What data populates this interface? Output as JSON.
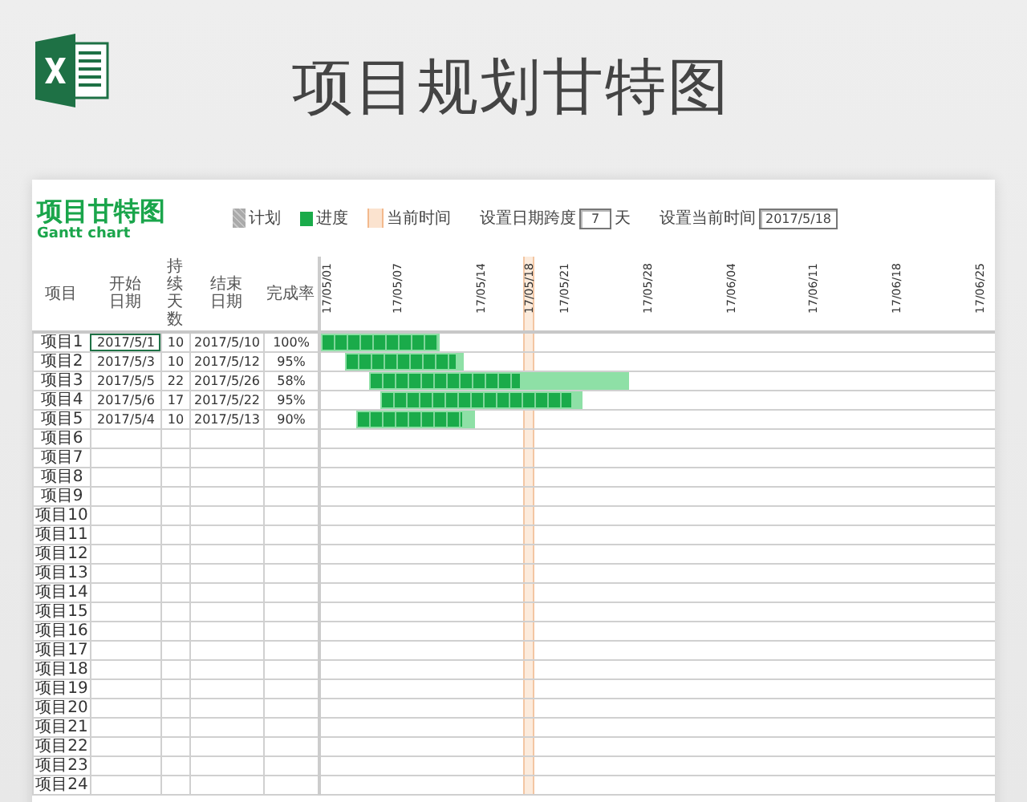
{
  "header": {
    "title": "项目规划甘特图"
  },
  "sheet": {
    "title": "项目甘特图",
    "subtitle": "Gantt chart",
    "legend": [
      {
        "kind": "plan",
        "label": "计划"
      },
      {
        "kind": "progress",
        "label": "进度"
      },
      {
        "kind": "today",
        "label": "当前时间"
      }
    ],
    "span_setting": {
      "label": "设置日期跨度",
      "value": "7",
      "unit": "天"
    },
    "date_setting": {
      "label": "设置当前时间",
      "value": "2017/5/18"
    },
    "columns": [
      "项目",
      "开始日期",
      "持续天数",
      "结束日期",
      "完成率"
    ],
    "timeline": {
      "ticks": [
        "17/05/01",
        "17/05/07",
        "17/05/14",
        "17/05/21",
        "17/05/28",
        "17/06/04",
        "17/06/11",
        "17/06/18",
        "17/06/25"
      ],
      "current_label": "17/05/18"
    },
    "rows": [
      {
        "name": "项目1",
        "start": "2017/5/1",
        "days": "10",
        "end": "2017/5/10",
        "rate": "100%",
        "level": 1,
        "selected": true
      },
      {
        "name": "项目2",
        "start": "2017/5/3",
        "days": "10",
        "end": "2017/5/12",
        "rate": "95%",
        "level": 0.95,
        "selected": false
      },
      {
        "name": "项目3",
        "start": "2017/5/5",
        "days": "22",
        "end": "2017/5/26",
        "rate": "58%",
        "level": 0.58,
        "selected": false
      },
      {
        "name": "项目4",
        "start": "2017/5/6",
        "days": "17",
        "end": "2017/5/22",
        "rate": "95%",
        "level": 0.95,
        "selected": false
      },
      {
        "name": "项目5",
        "start": "2017/5/4",
        "days": "10",
        "end": "2017/5/13",
        "rate": "90%",
        "level": 0.9,
        "selected": false
      },
      {
        "name": "项目6"
      },
      {
        "name": "项目7"
      },
      {
        "name": "项目8"
      },
      {
        "name": "项目9"
      },
      {
        "name": "项目10"
      },
      {
        "name": "项目11"
      },
      {
        "name": "项目12"
      },
      {
        "name": "项目13"
      },
      {
        "name": "项目14"
      },
      {
        "name": "项目15"
      },
      {
        "name": "项目16"
      },
      {
        "name": "项目17"
      },
      {
        "name": "项目18"
      },
      {
        "name": "项目19"
      },
      {
        "name": "项目20"
      },
      {
        "name": "项目21"
      },
      {
        "name": "项目22"
      },
      {
        "name": "项目23"
      },
      {
        "name": "项目24"
      }
    ]
  }
}
